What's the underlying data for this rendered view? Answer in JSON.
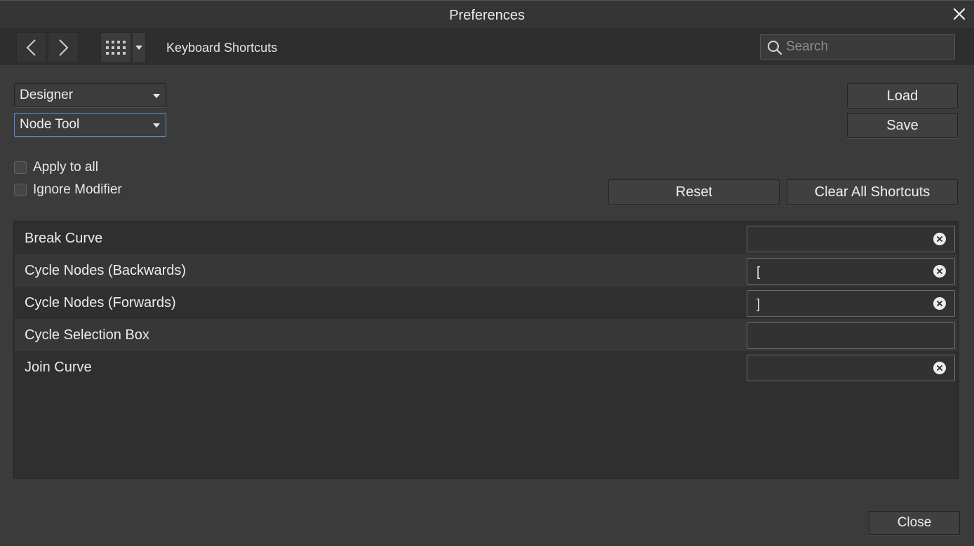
{
  "window": {
    "title": "Preferences"
  },
  "toolbar": {
    "section_label": "Keyboard Shortcuts",
    "search_placeholder": "Search"
  },
  "selects": {
    "app": "Designer",
    "tool": "Node Tool"
  },
  "buttons": {
    "load": "Load",
    "save": "Save",
    "reset": "Reset",
    "clear_all": "Clear All Shortcuts",
    "close": "Close"
  },
  "options": {
    "apply_to_all": "Apply to all",
    "ignore_modifier": "Ignore Modifier"
  },
  "shortcuts": [
    {
      "label": "Break Curve",
      "key": ""
    },
    {
      "label": "Cycle Nodes (Backwards)",
      "key": "["
    },
    {
      "label": "Cycle Nodes (Forwards)",
      "key": "]"
    },
    {
      "label": "Cycle Selection Box",
      "key": ""
    },
    {
      "label": "Join Curve",
      "key": ""
    }
  ]
}
